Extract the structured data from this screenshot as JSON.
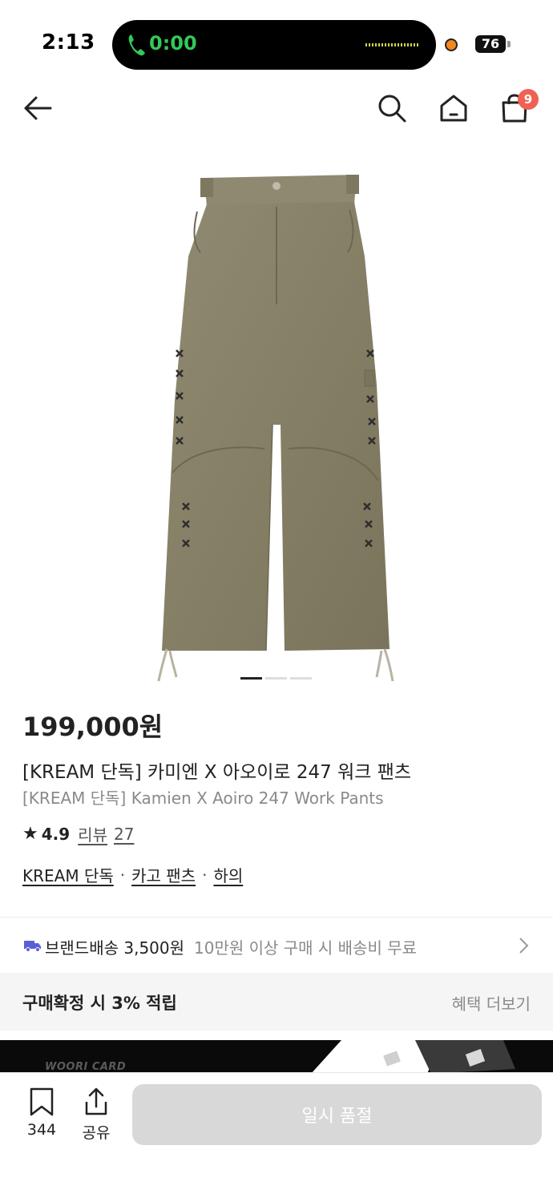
{
  "status_bar": {
    "time": "2:13",
    "call_time": "0:00",
    "battery": "76",
    "call_color": "#34c759",
    "recording_dot_color": "#f2891c"
  },
  "nav": {
    "back_icon": "arrow-left-icon",
    "search_icon": "search-icon",
    "home_icon": "home-icon",
    "cart_icon": "shopping-bag-icon",
    "cart_count": "9",
    "badge_color": "#ef6253"
  },
  "product": {
    "image_indicator_count": 3,
    "image_indicator_active": 0,
    "price": "199,000원",
    "name_ko": "[KREAM 단독] 카미엔 X 아오이로 247 워크 팬츠",
    "name_en": "[KREAM 단독] Kamien X Aoiro 247 Work Pants",
    "rating": "4.9",
    "review_label": "리뷰",
    "review_count": "27",
    "tags": [
      "KREAM 단독",
      "카고 팬츠",
      "하의"
    ],
    "tag_separator": "·"
  },
  "shipping": {
    "label": "브랜드배송 3,500원",
    "description": "10만원 이상 구매 시 배송비 무료",
    "icon": "truck-icon",
    "icon_color": "#5b5fd6"
  },
  "benefit": {
    "label": "구매확정 시 3% 적립",
    "more": "혜택 더보기"
  },
  "banner": {
    "text": "WOORI CARD"
  },
  "bottom_bar": {
    "save_count": "344",
    "share_label": "공유",
    "soldout_label": "일시 품절"
  }
}
